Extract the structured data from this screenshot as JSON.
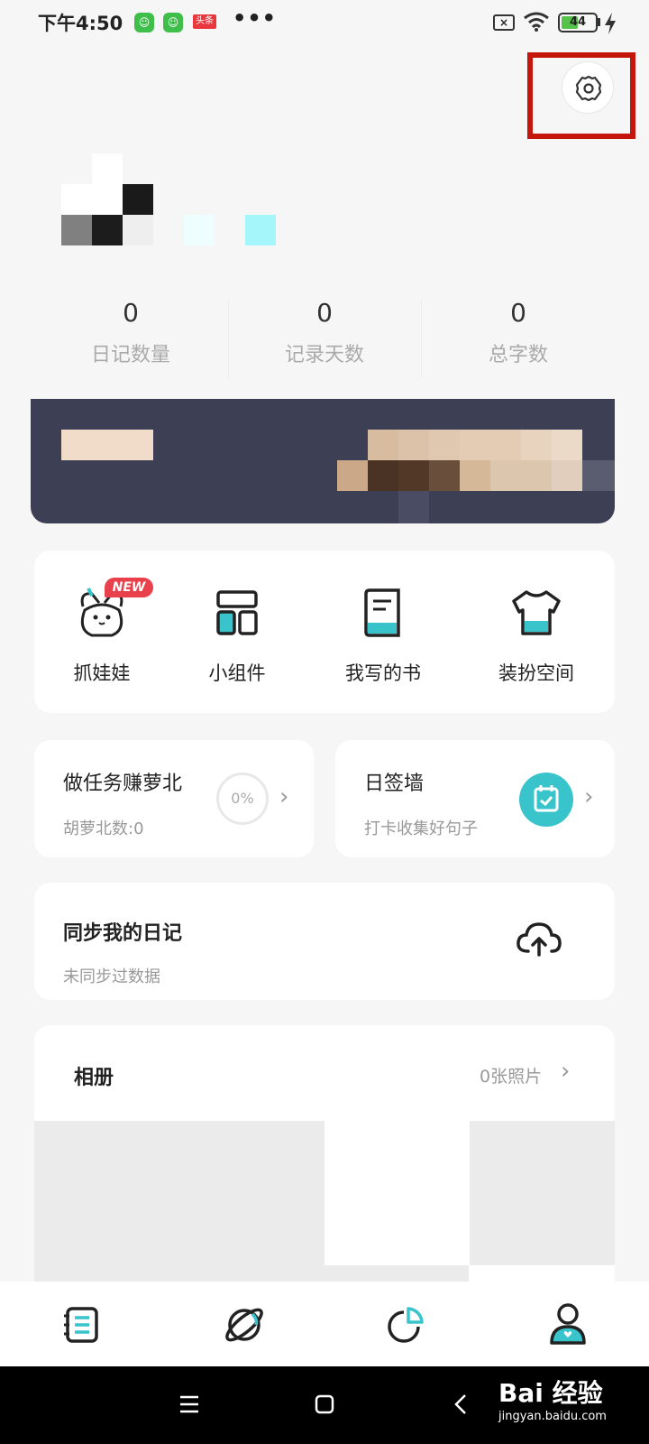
{
  "status_bar": {
    "time": "下午4:50",
    "toutiao": "头条",
    "more": "•••",
    "sim_label": "×",
    "battery": "44"
  },
  "stats": [
    {
      "value": "0",
      "label": "日记数量"
    },
    {
      "value": "0",
      "label": "记录天数"
    },
    {
      "value": "0",
      "label": "总字数"
    }
  ],
  "tools": {
    "new_badge": "NEW",
    "items": [
      {
        "label": "抓娃娃",
        "icon": "claw-doll-icon"
      },
      {
        "label": "小组件",
        "icon": "widget-icon"
      },
      {
        "label": "我写的书",
        "icon": "book-icon"
      },
      {
        "label": "装扮空间",
        "icon": "shirt-icon"
      }
    ]
  },
  "task_card": {
    "title": "做任务赚萝北",
    "subtitle": "胡萝北数:0",
    "progress": "0%"
  },
  "sign_card": {
    "title": "日签墙",
    "subtitle": "打卡收集好句子"
  },
  "sync_card": {
    "title": "同步我的日记",
    "subtitle": "未同步过数据"
  },
  "album": {
    "title": "相册",
    "count": "0张照片"
  },
  "bottom_nav": [
    "diary-icon",
    "planet-icon",
    "stats-icon",
    "profile-icon"
  ],
  "watermark": {
    "brand": "Bai 经验",
    "url": "jingyan.baidu.com"
  },
  "colors": {
    "accent": "#39c4cc",
    "highlight": "#c5160e",
    "banner": "#3d3f55"
  }
}
